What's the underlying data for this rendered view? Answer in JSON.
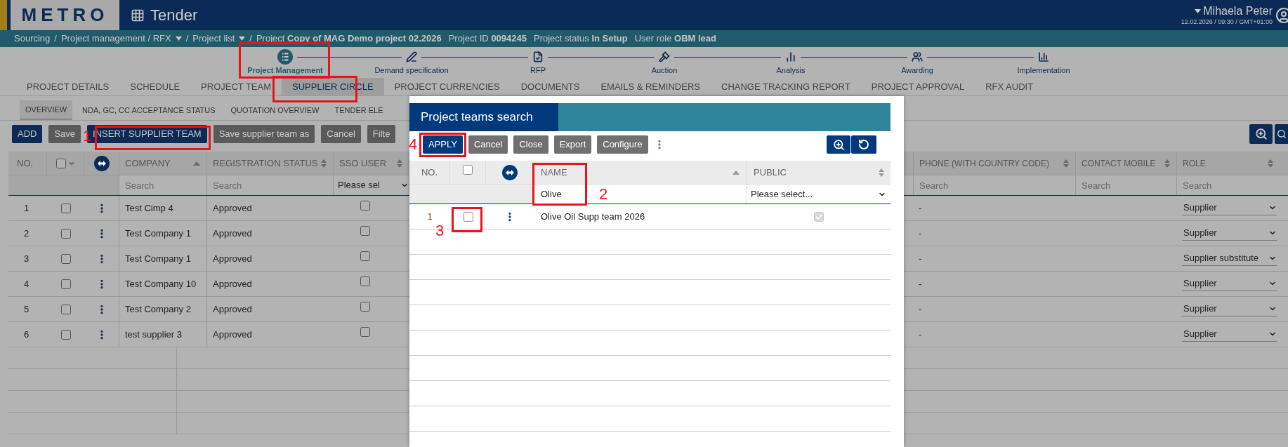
{
  "app": {
    "logo": "METRO",
    "title": "Tender"
  },
  "user": {
    "name": "Mihaela Peter",
    "dropdown": true,
    "datetime": "12.02.2026 / 09:30 / GMT+01:00"
  },
  "breadcrumb": {
    "separator": "/",
    "items": [
      {
        "label": "Sourcing",
        "dropdown": false
      },
      {
        "label": "Project management / RFX",
        "dropdown": true
      },
      {
        "label": "Project list",
        "dropdown": true
      }
    ],
    "project": {
      "label": "Project",
      "value": "Copy of MAG Demo project 02.2026"
    },
    "info": [
      {
        "label": "Project ID",
        "value": "0094245"
      },
      {
        "label": "Project status",
        "value": "In Setup"
      },
      {
        "label": "User role",
        "value": "OBM lead"
      }
    ]
  },
  "stepper": [
    {
      "label": "Project Management",
      "selected": true
    },
    {
      "label": "Demand specification",
      "selected": false
    },
    {
      "label": "RFP",
      "selected": false
    },
    {
      "label": "Auction",
      "selected": false
    },
    {
      "label": "Analysis",
      "selected": false
    },
    {
      "label": "Awarding",
      "selected": false
    },
    {
      "label": "Implementation",
      "selected": false
    }
  ],
  "tabs": [
    {
      "label": "PROJECT DETAILS",
      "selected": false
    },
    {
      "label": "SCHEDULE",
      "selected": false
    },
    {
      "label": "PROJECT TEAM",
      "selected": false
    },
    {
      "label": "SUPPLIER CIRCLE",
      "selected": true
    },
    {
      "label": "PROJECT CURRENCIES",
      "selected": false
    },
    {
      "label": "DOCUMENTS",
      "selected": false
    },
    {
      "label": "EMAILS & REMINDERS",
      "selected": false
    },
    {
      "label": "CHANGE TRACKING REPORT",
      "selected": false
    },
    {
      "label": "PROJECT APPROVAL",
      "selected": false
    },
    {
      "label": "RFX AUDIT",
      "selected": false
    }
  ],
  "subtabs": [
    {
      "label": "OVERVIEW",
      "selected": true
    },
    {
      "label": "NDA, GC, CC ACCEPTANCE STATUS",
      "selected": false
    },
    {
      "label": "QUOTATION OVERVIEW",
      "selected": false
    },
    {
      "label": "TENDER ELE",
      "selected": false
    }
  ],
  "toolbar": [
    {
      "label": "ADD",
      "kind": "primary"
    },
    {
      "label": "Save",
      "kind": "secondary"
    },
    {
      "label": "INSERT SUPPLIER TEAM",
      "kind": "primary"
    },
    {
      "label": "Save supplier team as",
      "kind": "secondary"
    },
    {
      "label": "Cancel",
      "kind": "secondary"
    },
    {
      "label": "Filte",
      "kind": "secondary"
    }
  ],
  "table": {
    "no_label": "NO.",
    "select_all": false,
    "columns_left": [
      {
        "label": "COMPANY",
        "sorted": true,
        "placeholder": "Search"
      },
      {
        "label": "REGISTRATION STATUS",
        "sorted": false,
        "placeholder": "Search"
      },
      {
        "label": "SSO USER",
        "sorted": false,
        "select": "Please sel"
      }
    ],
    "columns_right": [
      {
        "label": "PHONE (WITH COUNTRY CODE)",
        "sorted": false,
        "placeholder": "Search"
      },
      {
        "label": "CONTACT MOBILE",
        "sorted": false,
        "placeholder": "Search"
      },
      {
        "label": "ROLE",
        "sorted": false,
        "placeholder": "Search"
      }
    ],
    "rows": [
      {
        "no": "1",
        "checked": false,
        "company": "Test Cimp 4",
        "registration_status": "Approved",
        "sso_user": false,
        "phone": "-",
        "role": "Supplier"
      },
      {
        "no": "2",
        "checked": false,
        "company": "Test Company 1",
        "registration_status": "Approved",
        "sso_user": false,
        "phone": "-",
        "role": "Supplier"
      },
      {
        "no": "3",
        "checked": false,
        "company": "Test Company 1",
        "registration_status": "Approved",
        "sso_user": false,
        "phone": "-",
        "role": "Supplier substitute"
      },
      {
        "no": "4",
        "checked": false,
        "company": "Test Company 10",
        "registration_status": "Approved",
        "sso_user": false,
        "phone": "-",
        "role": "Supplier"
      },
      {
        "no": "5",
        "checked": false,
        "company": "Test Company 2",
        "registration_status": "Approved",
        "sso_user": false,
        "phone": "-",
        "role": "Supplier"
      },
      {
        "no": "6",
        "checked": false,
        "company": "test supplier 3",
        "registration_status": "Approved",
        "sso_user": false,
        "phone": "-",
        "role": "Supplier"
      }
    ]
  },
  "modal": {
    "title": "Project teams search",
    "buttons": [
      {
        "label": "APPLY",
        "kind": "primary"
      },
      {
        "label": "Cancel",
        "kind": "secondary"
      },
      {
        "label": "Close",
        "kind": "secondary"
      },
      {
        "label": "Export",
        "kind": "secondary"
      },
      {
        "label": "Configure",
        "kind": "secondary"
      }
    ],
    "table": {
      "no_label": "NO.",
      "select_all": false,
      "columns": [
        {
          "label": "NAME",
          "sorted": true
        },
        {
          "label": "PUBLIC",
          "sorted": false
        }
      ],
      "name_filter": "Olive",
      "public_filter": "Please select...",
      "rows": [
        {
          "no": "1",
          "checked": false,
          "name": "Olive Oil Supp team 2026",
          "public": true
        }
      ]
    }
  },
  "annotations": [
    "1",
    "2",
    "3",
    "4"
  ]
}
